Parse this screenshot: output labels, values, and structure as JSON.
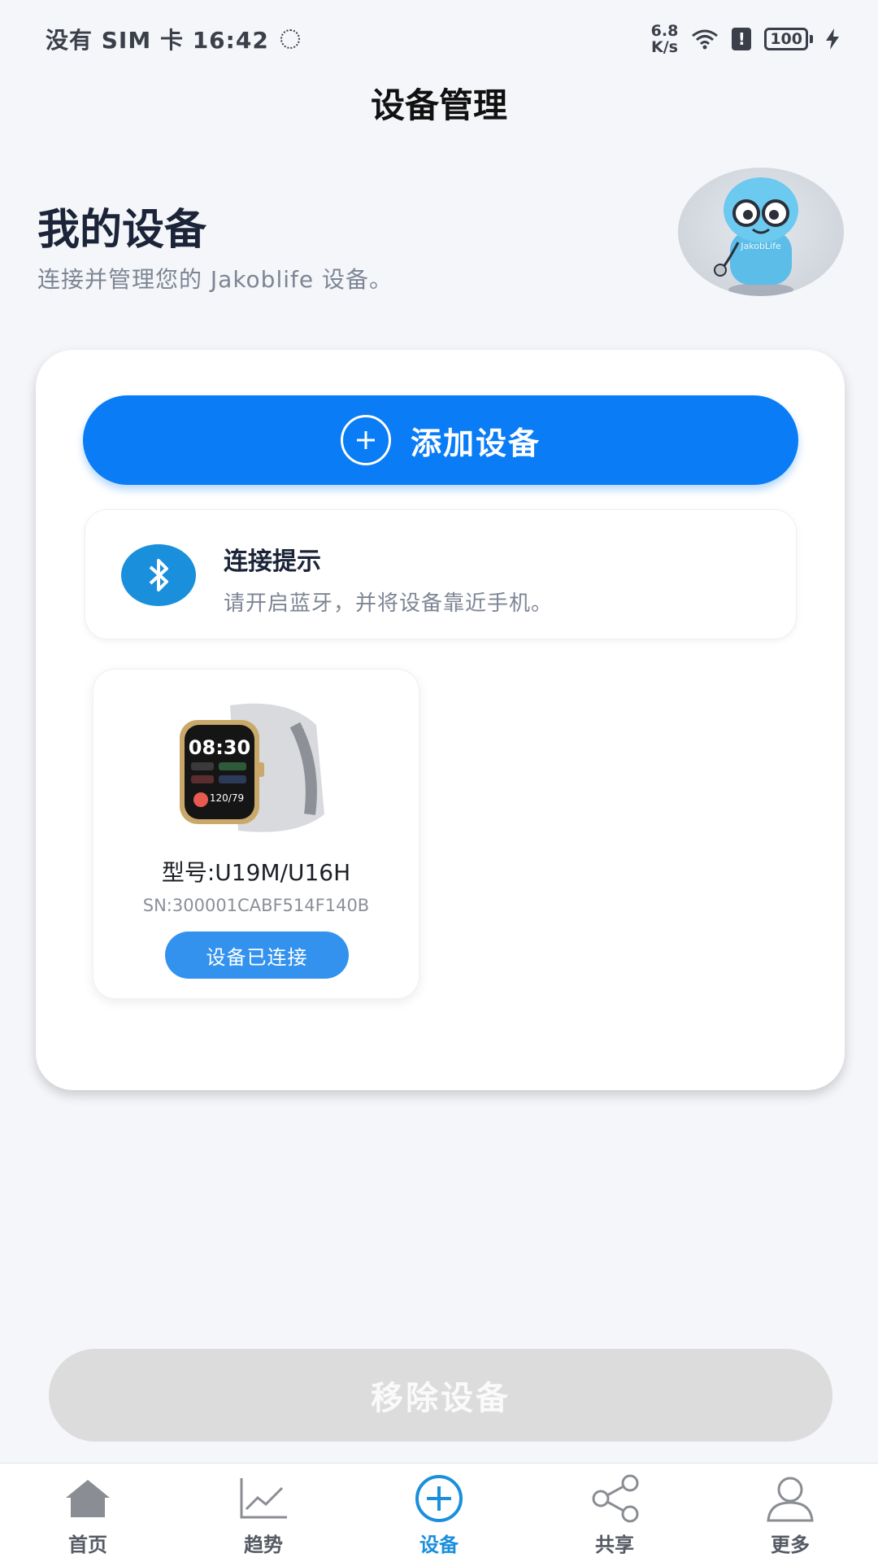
{
  "status_bar": {
    "carrier_time": "没有 SIM 卡 16:42",
    "net_speed_value": "6.8",
    "net_speed_unit": "K/s",
    "alert": "!",
    "battery": "100"
  },
  "page": {
    "title": "设备管理"
  },
  "header": {
    "title": "我的设备",
    "subtitle": "连接并管理您的 Jakoblife 设备。",
    "mascot_text": "JakobLife"
  },
  "add_button": {
    "label": "添加设备",
    "icon": "plus-circle-icon"
  },
  "tip": {
    "icon": "bluetooth-icon",
    "title": "连接提示",
    "text": "请开启蓝牙，并将设备靠近手机。"
  },
  "device": {
    "watch_time": "08:30",
    "watch_bp": "120/79",
    "model": "型号:U19M/U16H",
    "sn": "SN:300001CABF514F140B",
    "status": "设备已连接"
  },
  "remove_button": {
    "label": "移除设备"
  },
  "nav": {
    "items": [
      {
        "label": "首页",
        "icon": "home-icon",
        "active": false
      },
      {
        "label": "趋势",
        "icon": "trend-icon",
        "active": false
      },
      {
        "label": "设备",
        "icon": "add-circle-icon",
        "active": true
      },
      {
        "label": "共享",
        "icon": "share-icon",
        "active": false
      },
      {
        "label": "更多",
        "icon": "user-icon",
        "active": false
      }
    ]
  },
  "colors": {
    "primary": "#0a7cf5",
    "bluetooth": "#1a8fdc",
    "connected_pill": "#3292ee",
    "disabled": "#dcdcdc",
    "nav_active": "#1a8fdc"
  }
}
